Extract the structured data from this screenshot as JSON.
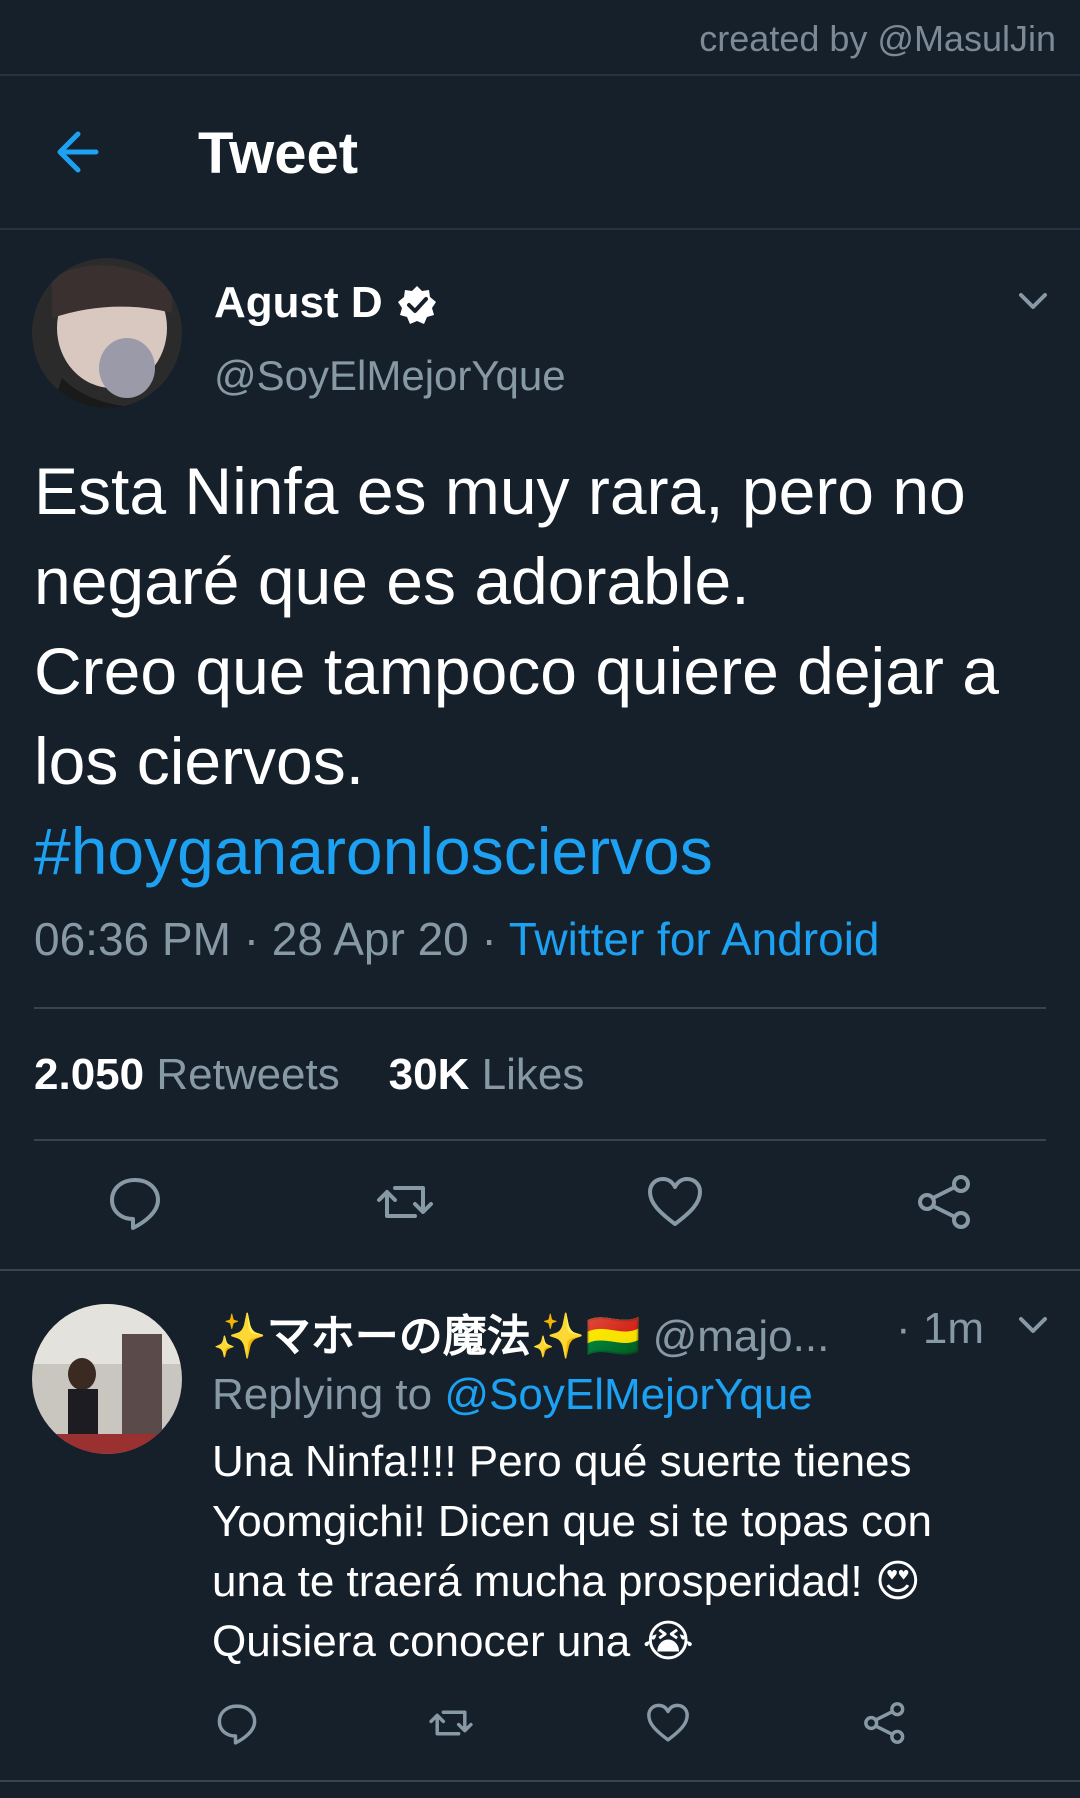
{
  "watermark": "created by @MasulJin",
  "app_bar": {
    "title": "Tweet"
  },
  "tweet": {
    "author_name": "Agust D",
    "author_handle": "@SoyElMejorYque",
    "text_lines": [
      "Esta Ninfa es muy rara, pero no",
      "negaré que es adorable.",
      "Creo que tampoco quiere dejar a",
      "los ciervos."
    ],
    "hashtag": "#hoyganaronlosciervos",
    "time": "06:36 PM",
    "date": "28 Apr 20",
    "separator": "·",
    "source": "Twitter for Android",
    "retweets_count": "2.050",
    "retweets_label": "Retweets",
    "likes_count": "30K",
    "likes_label": "Likes"
  },
  "reply": {
    "name": "✨マホーの魔法✨🇧🇴",
    "handle": "@majo...",
    "time": "· 1m",
    "replying_prefix": "Replying to",
    "replying_to": "@SoyElMejorYque",
    "text_lines": [
      "Una Ninfa!!!! Pero qué suerte tienes",
      "Yoomgichi! Dicen que si te topas con",
      "una te traerá mucha prosperidad! 😍",
      "Quisiera conocer una 😭"
    ]
  },
  "colors": {
    "background": "#15202b",
    "accent": "#1da1f2",
    "secondary_text": "#8899a6",
    "divider": "#38444d"
  },
  "icons": {
    "back": "arrow-left-icon",
    "verified": "verified-badge-icon",
    "menu": "chevron-down-icon",
    "reply": "comment-icon",
    "retweet": "retweet-icon",
    "like": "heart-icon",
    "share": "share-icon"
  }
}
